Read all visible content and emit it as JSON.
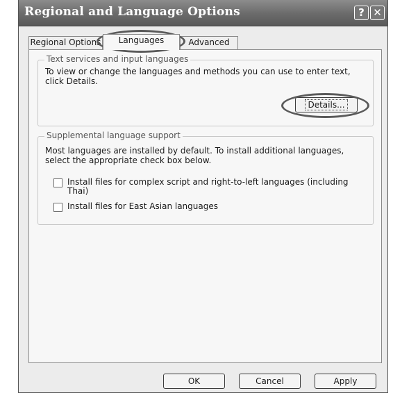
{
  "window": {
    "title": "Regional and Language Options",
    "help_glyph": "?",
    "close_glyph": "✕"
  },
  "tabs": [
    {
      "label": "Regional Options",
      "selected": false
    },
    {
      "label": "Languages",
      "selected": true
    },
    {
      "label": "Advanced",
      "selected": false
    }
  ],
  "text_services": {
    "legend": "Text services and input languages",
    "description": "To view or change the languages and methods you can use to enter text, click Details.",
    "details_button": "Details..."
  },
  "supplemental": {
    "legend": "Supplemental language support",
    "description": "Most languages are installed by default. To install additional languages, select the appropriate check box below.",
    "checkboxes": [
      {
        "label": "Install files for complex script and right-to-left languages (including Thai)",
        "checked": false
      },
      {
        "label": "Install files for East Asian languages",
        "checked": false
      }
    ]
  },
  "buttons": {
    "ok": "OK",
    "cancel": "Cancel",
    "apply": "Apply"
  },
  "colors": {
    "titlebar": "#6a6a6a",
    "dialog_background": "#ececec",
    "panel_background": "#f7f7f7",
    "annotation_circle": "#5a5a5a"
  }
}
